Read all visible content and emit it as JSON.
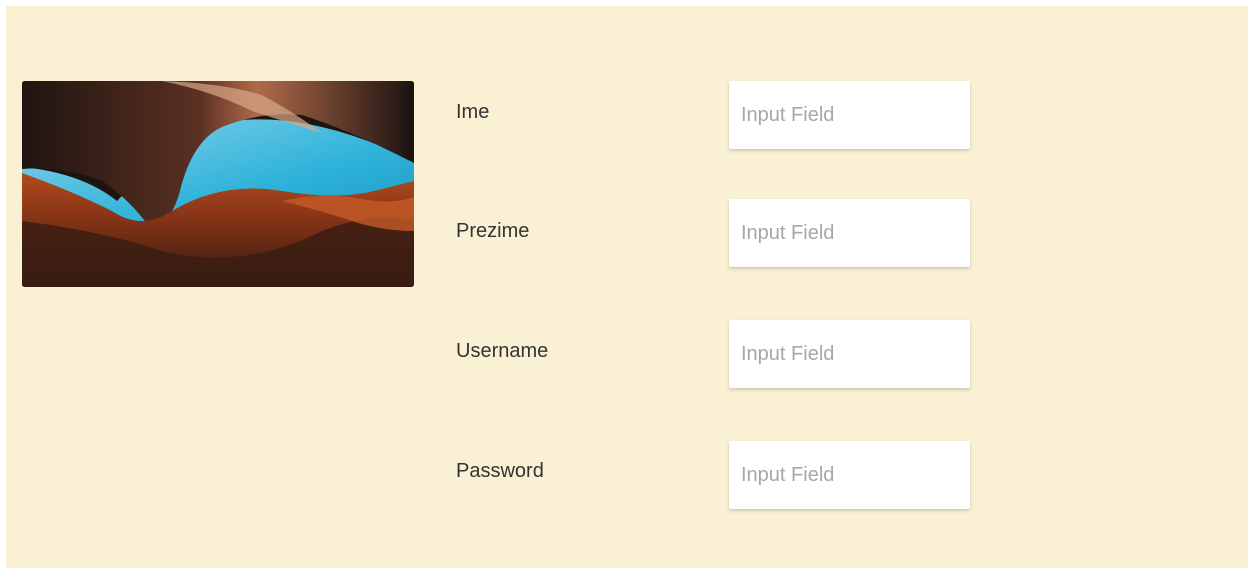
{
  "form": {
    "fields": [
      {
        "label": "Ime",
        "placeholder": "Input Field",
        "value": ""
      },
      {
        "label": "Prezime",
        "placeholder": "Input Field",
        "value": ""
      },
      {
        "label": "Username",
        "placeholder": "Input Field",
        "value": ""
      },
      {
        "label": "Password",
        "placeholder": "Input Field",
        "value": ""
      }
    ]
  },
  "colors": {
    "panel_background": "#faf0d4",
    "input_background": "#ffffff",
    "label_text": "#333333",
    "placeholder_text": "#a7a7a7"
  },
  "image": {
    "icon": "canyon-photo-icon"
  }
}
